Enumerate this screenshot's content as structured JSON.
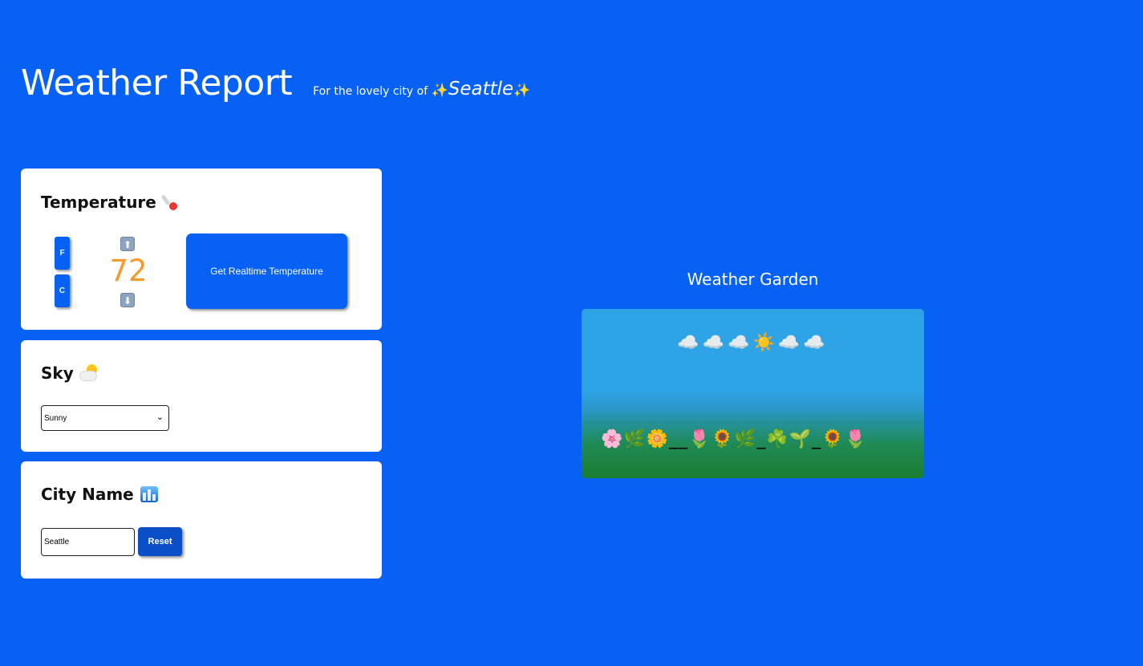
{
  "header": {
    "title": "Weather Report",
    "subtitle_prefix": "For the lovely city of",
    "city": "Seattle",
    "sparkle": "✨"
  },
  "temperature": {
    "title": "Temperature",
    "icon": "thermometer-icon",
    "unit_f": "F",
    "unit_c": "C",
    "value": "72",
    "arrow_up": "⬆",
    "arrow_down": "⬇",
    "realtime_button": "Get Realtime Temperature",
    "value_color": "#f79a2c"
  },
  "sky": {
    "title": "Sky",
    "icon": "sun-behind-cloud-icon",
    "selected": "Sunny",
    "chevron": "⌄"
  },
  "city_card": {
    "title": "City Name",
    "icon": "cityscape-icon",
    "input_value": "Seattle",
    "reset_label": "Reset"
  },
  "garden": {
    "title": "Weather Garden",
    "sky_emojis": "☁️☁️☁️☀️☁️☁️",
    "ground_emojis": "🌸🌿🌼__🌷🌻🌿_☘️🌱_🌻🌷"
  },
  "colors": {
    "background": "#0761f5",
    "button": "#0761f5",
    "reset_button": "#0a4fc8"
  }
}
